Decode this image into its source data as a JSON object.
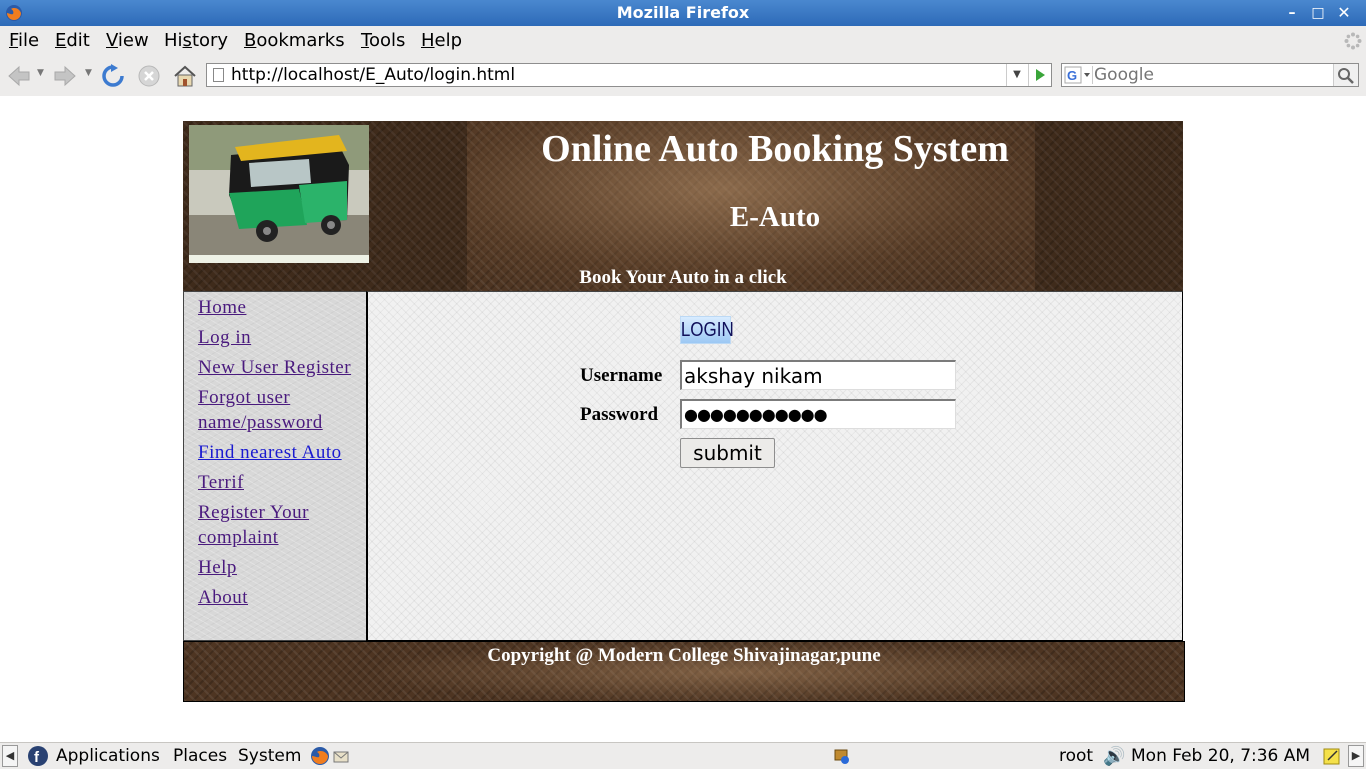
{
  "window": {
    "title": "Mozilla Firefox"
  },
  "menubar": {
    "items": [
      {
        "label": "File",
        "accel": "F",
        "rest": "ile"
      },
      {
        "label": "Edit",
        "accel": "E",
        "rest": "dit"
      },
      {
        "label": "View",
        "accel": "V",
        "rest": "iew"
      },
      {
        "label": "History",
        "pre": "Hi",
        "accel": "s",
        "rest": "tory"
      },
      {
        "label": "Bookmarks",
        "accel": "B",
        "rest": "ookmarks"
      },
      {
        "label": "Tools",
        "accel": "T",
        "rest": "ools"
      },
      {
        "label": "Help",
        "accel": "H",
        "rest": "elp"
      }
    ]
  },
  "toolbar": {
    "url": "http://localhost/E_Auto/login.html",
    "search_placeholder": "Google",
    "icons": [
      "back-icon",
      "forward-icon",
      "reload-icon",
      "stop-icon",
      "home-icon",
      "go-icon",
      "search-icon"
    ]
  },
  "header": {
    "title": "Online Auto Booking System",
    "subtitle": "E-Auto",
    "tagline": "Book Your Auto in a click"
  },
  "sidebar": {
    "links": [
      {
        "label": "Home",
        "lines": [
          "Home"
        ]
      },
      {
        "label": "Log in",
        "lines": [
          "Log in"
        ]
      },
      {
        "label": "New User Register",
        "lines": [
          "New User Register"
        ]
      },
      {
        "label": "Forgot user name/password",
        "lines": [
          "Forgot user",
          "name/password"
        ]
      },
      {
        "label": "Find nearest Auto",
        "lines": [
          "Find nearest Auto"
        ]
      },
      {
        "label": "Terrif",
        "lines": [
          "Terrif"
        ]
      },
      {
        "label": "Register Your complaint",
        "lines": [
          "Register Your",
          "complaint"
        ]
      },
      {
        "label": "Help",
        "lines": [
          "Help"
        ]
      },
      {
        "label": "About",
        "lines": [
          "About"
        ]
      }
    ]
  },
  "login": {
    "heading_image_text": "LOGIN",
    "username_label": "Username",
    "username_value": "akshay nikam",
    "password_label": "Password",
    "password_value": "●●●●●●●●●●●",
    "submit_label": "submit"
  },
  "footer": {
    "text": "Copyright @ Modern College Shivajinagar,pune"
  },
  "taskbar": {
    "applications": "Applications",
    "places": "Places",
    "system": "System",
    "user": "root",
    "clock": "Mon Feb 20,  7:36 AM"
  },
  "colors": {
    "titlebar": "#3b7cc4",
    "header_brown": "#4e3522",
    "link_visited": "#4a1a7e",
    "link_active": "#1a1ad0"
  }
}
